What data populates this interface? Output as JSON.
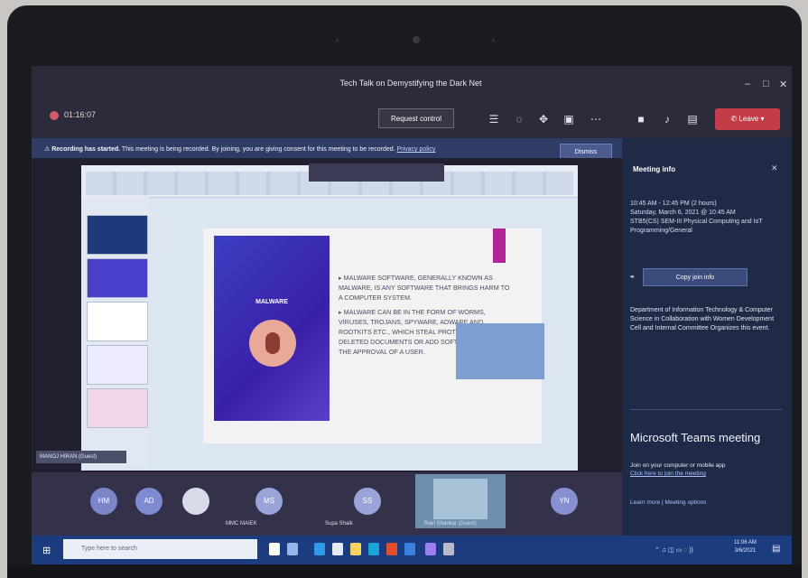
{
  "window": {
    "title": "Tech Talk on Demystifying the Dark Net"
  },
  "toolbar": {
    "timer": "01:16:07",
    "request_control": "Request control",
    "leave": "Leave"
  },
  "banner": {
    "bold_text": "Recording has started.",
    "text": "This meeting is being recorded. By joining, you are giving consent for this meeting to be recorded.",
    "link": "Privacy policy",
    "dismiss": "Dismiss"
  },
  "slide": {
    "title": "MALWARE",
    "bullet1": "MALWARE SOFTWARE, GENERALLY KNOWN AS MALWARE, IS ANY SOFTWARE THAT BRINGS HARM TO A COMPUTER SYSTEM.",
    "bullet2": "MALWARE CAN BE IN THE FORM OF WORMS, VIRUSES, TROJANS, SPYWARE, ADWARE AND ROOTKITS ETC., WHICH STEAL PROTECTED DATA, DELETED DOCUMENTS OR ADD SOFTWARE WITHOUT THE APPROVAL OF A USER."
  },
  "presenter_name": "MANOJ HIRAN (Guest)",
  "participants": [
    {
      "initials": "HM",
      "name": ""
    },
    {
      "initials": "AD",
      "name": ""
    },
    {
      "initials": "",
      "name": ""
    },
    {
      "initials": "MS",
      "name": "MMC MAIEK"
    },
    {
      "initials": "SS",
      "name": "Supa Shaik"
    },
    {
      "initials": "YN",
      "name": ""
    }
  ],
  "video_tile_name": "Ravi Shankar (Guest)",
  "panel": {
    "title": "Meeting info",
    "time_line1": "10:45 AM - 12:45 PM (2 hours)",
    "time_line2": "Saturday, March 6, 2021 @ 10:45 AM",
    "time_line3": "STB5(CS) SEM-III Physical Computing and IoT Programming/General",
    "copy_button": "Copy join info",
    "dept_text": "Department of Information Technology & Computer Science in Collaboration with Women Development Cell and Internal Committee Organizes this event.",
    "teams_heading": "Microsoft Teams meeting",
    "join_text": "Join on your computer or mobile app",
    "join_link": "Click here to join the meeting",
    "learn_more": "Learn more | Meeting options"
  },
  "taskbar": {
    "search_placeholder": "Type here to search",
    "clock_time": "11:06 AM",
    "clock_date": "3/6/2021"
  }
}
